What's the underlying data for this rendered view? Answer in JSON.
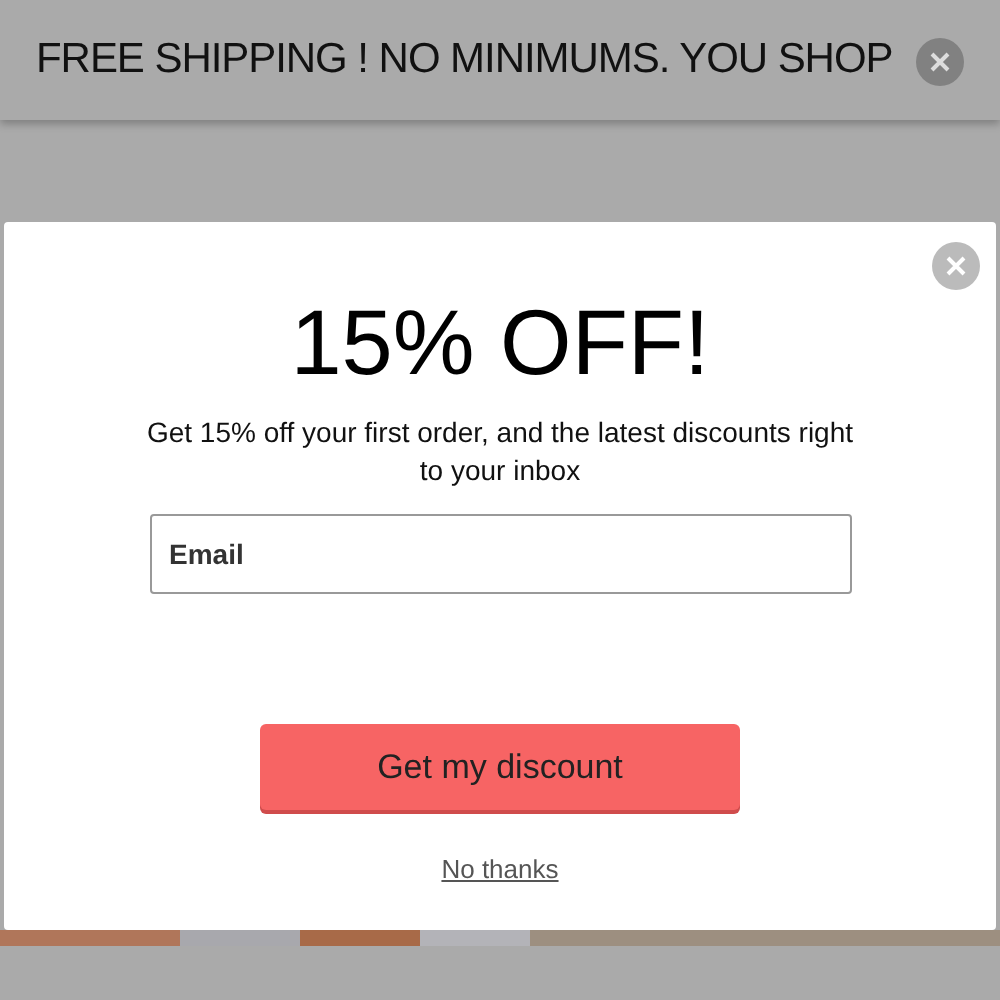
{
  "banner": {
    "text": "FREE SHIPPING  ! NO MINIMUMS. YOU SHOP"
  },
  "popup": {
    "title": "15% OFF!",
    "message": "Get 15% off your first order, and the latest discounts right to your inbox",
    "email": {
      "placeholder": "Email"
    },
    "submit": "Get my discount",
    "dismiss": "No thanks"
  }
}
